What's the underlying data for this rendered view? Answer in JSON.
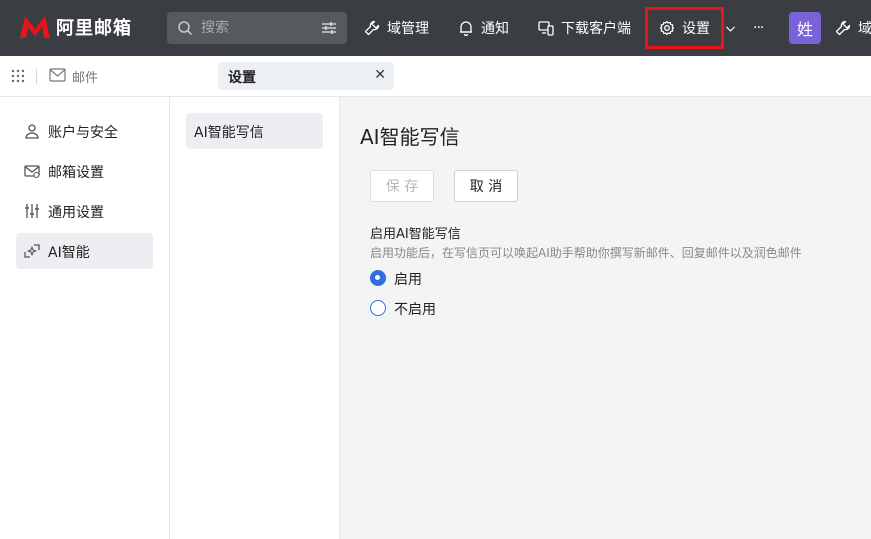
{
  "app": {
    "logo_text": "阿里邮箱",
    "brand_color": "#e8141b"
  },
  "search": {
    "placeholder": "搜索"
  },
  "nav": {
    "domain_admin": "域管理",
    "notifications": "通知",
    "download_client": "下载客户端",
    "settings": "设置",
    "more": "···",
    "avatar_text": "姓",
    "domain_cut": "域"
  },
  "tabs": {
    "mail_label": "邮件",
    "settings_label": "设置",
    "close": "✕"
  },
  "sidebar": {
    "items": [
      {
        "label": "账户与安全",
        "icon": "user-icon"
      },
      {
        "label": "邮箱设置",
        "icon": "mailbox-icon"
      },
      {
        "label": "通用设置",
        "icon": "sliders-icon"
      },
      {
        "label": "AI智能",
        "icon": "ai-sparkle-icon",
        "active": true
      }
    ]
  },
  "submenu": {
    "items": [
      {
        "label": "AI智能写信",
        "active": true
      }
    ]
  },
  "content": {
    "title": "AI智能写信",
    "save_label": "保 存",
    "cancel_label": "取 消",
    "section_title": "启用AI智能写信",
    "section_desc": "启用功能后，在写信页可以唤起AI助手帮助你撰写新邮件、回复邮件以及润色邮件",
    "options": [
      {
        "label": "启用",
        "checked": true
      },
      {
        "label": "不启用",
        "checked": false
      }
    ],
    "accent_color": "#2f6de1"
  }
}
